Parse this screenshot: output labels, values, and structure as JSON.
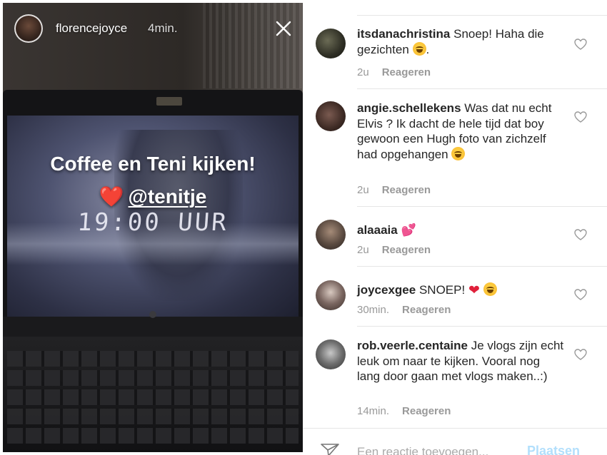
{
  "story": {
    "username": "florencejoyce",
    "time": "4min.",
    "caption": "Coffee en Teni kijken!",
    "mention_heart": "❤️",
    "mention_handle": "@tenitje",
    "handwritten": "19:00 UUR"
  },
  "comments": [
    {
      "username": "itsdanachristina",
      "text": "Snoep! Haha die gezichten",
      "emoji_after": "😂",
      "suffix": ".",
      "age": "2u",
      "reply_label": "Reageren"
    },
    {
      "username": "angie.schellekens",
      "text": "Was dat nu echt Elvis ? Ik dacht de hele tijd dat boy gewoon een Hugh foto van zichzelf had opgehangen",
      "emoji_after": "😂",
      "age": "2u",
      "reply_label": "Reageren"
    },
    {
      "username": "alaaaia",
      "text": "",
      "emoji_after": "💕",
      "age": "2u",
      "reply_label": "Reageren"
    },
    {
      "username": "joycexgee",
      "text": "SNOEP!",
      "emoji_after": "❤️ 😂",
      "age": "30min.",
      "reply_label": "Reageren"
    },
    {
      "username": "rob.veerle.centaine",
      "text": "Je vlogs zijn echt leuk om naar te kijken. Vooral nog lang door gaan met vlogs maken..:)",
      "age": "14min.",
      "reply_label": "Reageren"
    }
  ],
  "composer": {
    "placeholder": "Een reactie toevoegen...",
    "post_label": "Plaatsen"
  },
  "icons": {
    "close": "close-icon",
    "like": "heart-outline-icon",
    "send": "paper-plane-icon"
  },
  "colors": {
    "post_button": "#b2dffc",
    "meta_text": "#999999",
    "heart": "#e8303d"
  }
}
